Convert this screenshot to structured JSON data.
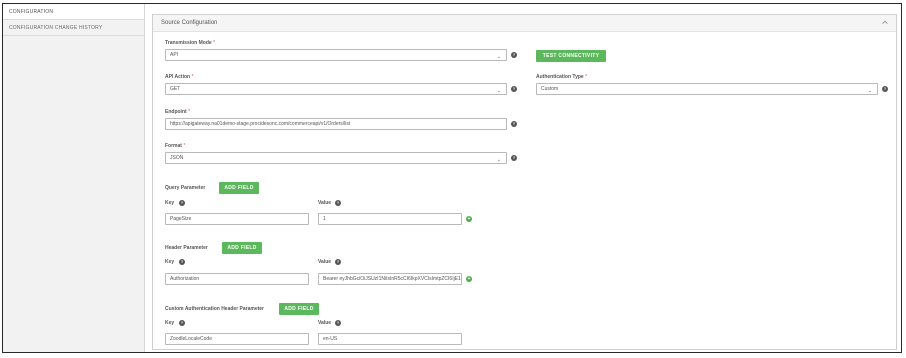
{
  "sidebar": {
    "items": [
      {
        "label": "CONFIGURATION"
      },
      {
        "label": "CONFIGURATION CHANGE HISTORY"
      }
    ]
  },
  "panel": {
    "title": "Source Configuration"
  },
  "transmission_mode": {
    "label": "Transmission Mode",
    "value": "API",
    "test_button": "TEST CONNECTIVITY"
  },
  "api_action": {
    "label": "API Action",
    "value": "GET"
  },
  "auth_type": {
    "label": "Authentication Type",
    "value": "Custom"
  },
  "endpoint": {
    "label": "Endpoint",
    "value": "https://apigateway.na01demo-stage.procidesonc.com/commerceapi/v1/Orders/list"
  },
  "format": {
    "label": "Format",
    "value": "JSON"
  },
  "query_params": {
    "label": "Query Parameter",
    "add_button": "ADD FIELD",
    "key_label": "Key",
    "value_label": "Value",
    "key": "PageSize",
    "value": "1"
  },
  "header_params": {
    "label": "Header Parameter",
    "add_button": "ADD FIELD",
    "key_label": "Key",
    "value_label": "Value",
    "key": "Authorization",
    "value": "Bearer eyJhbGciOiJSUzI1NiIsInR5cCI6IkpXVCIsImtpZCI6IjE1"
  },
  "custom_auth": {
    "label": "Custom Authentication Header Parameter",
    "add_button": "ADD FIELD",
    "key_label": "Key",
    "value_label": "Value",
    "key": "ZoodleLocaleCode",
    "value": "en-US"
  },
  "colors": {
    "accent": "#5cb85c",
    "required": "#d9534f"
  }
}
